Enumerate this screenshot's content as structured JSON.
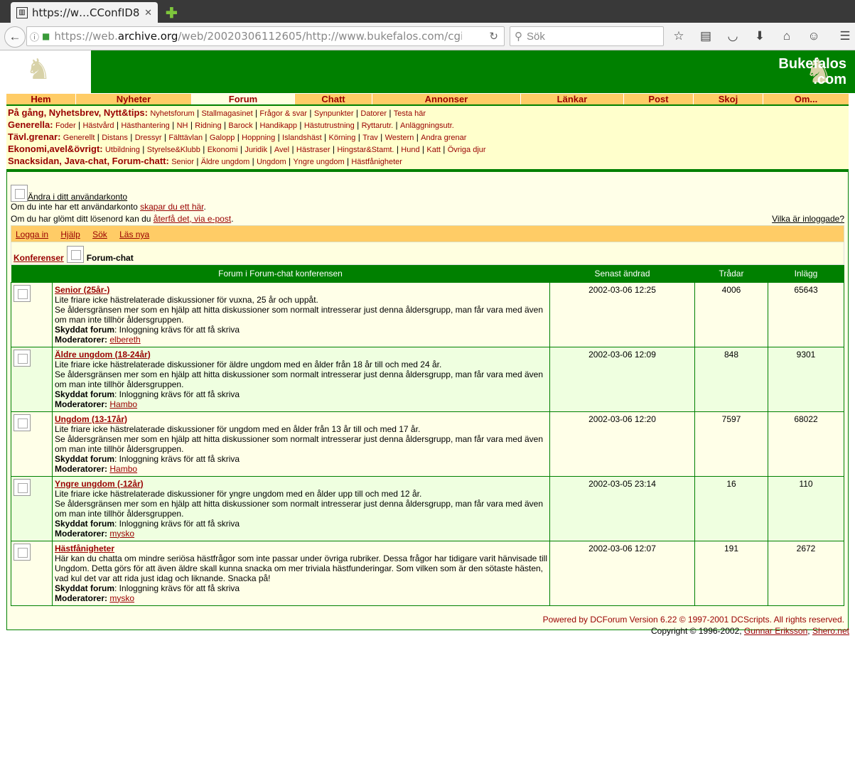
{
  "browser": {
    "tab_title": "https://w…CConfID8",
    "tab_close": "✕",
    "url_prefix": "https://web.",
    "url_host": "archive.org",
    "url_path": "/web/20020306112605/http://www.bukefalos.com/cgi/dcf/",
    "search_placeholder": "Sök"
  },
  "banner": {
    "brand_line1": "Bukefalos",
    "brand_line2": ".com"
  },
  "menu": [
    "Hem",
    "Nyheter",
    "Forum",
    "Chatt",
    "Annonser",
    "Länkar",
    "Post",
    "Skoj",
    "Om..."
  ],
  "subnav": [
    {
      "head": "På gång, Nyhetsbrev, Nytt&tips:",
      "links": [
        "Nyhetsforum",
        "Stallmagasinet",
        "Frågor & svar",
        "Synpunkter",
        "Datorer",
        "Testa här"
      ]
    },
    {
      "head": "Generella:",
      "links": [
        "Foder",
        "Hästvård",
        "Hästhantering",
        "NH",
        "Ridning",
        "Barock",
        "Handikapp",
        "Hästutrustning",
        "Ryttarutr.",
        "Anläggningsutr."
      ]
    },
    {
      "head": "Tävl.grenar:",
      "links": [
        "Generellt",
        "Distans",
        "Dressyr",
        "Fälttävlan",
        "Galopp",
        "Hoppning",
        "Islandshäst",
        "Körning",
        "Trav",
        "Western",
        "Andra grenar"
      ]
    },
    {
      "head": "Ekonomi,avel&övrigt:",
      "links": [
        "Utbildning",
        "Styrelse&Klubb",
        "Ekonomi",
        "Juridik",
        "Avel",
        "Hästraser",
        "Hingstar&Stamt.",
        "Hund",
        "Katt",
        "Övriga djur"
      ]
    },
    {
      "head": "Snacksidan, Java-chat, Forum-chatt:",
      "links": [
        "Senior",
        "Äldre ungdom",
        "Ungdom",
        "Yngre ungdom",
        "Hästfånigheter"
      ]
    }
  ],
  "account": {
    "edit": "Ändra i ditt användarkonto",
    "no_account": "Om du inte har ett användarkonto ",
    "create_link": "skapar du ett här",
    "forgot": "Om du har glömt ditt lösenord kan du ",
    "forgot_link": "återfå det, via e-post",
    "who": "Vilka är inloggade?"
  },
  "actions": [
    "Logga in",
    "Hjälp",
    "Sök",
    "Läs nya"
  ],
  "crumb": {
    "conf": "Konferenser",
    "current": "Forum-chat"
  },
  "table": {
    "headers": [
      "Forum i Forum-chat konferensen",
      "Senast ändrad",
      "Trådar",
      "Inlägg"
    ],
    "rows": [
      {
        "name": "Senior (25år-)",
        "desc": "Lite friare icke hästrelaterade diskussioner för vuxna, 25 år och uppåt.",
        "age": "Se åldersgränsen mer som en hjälp att hitta diskussioner som normalt intresserar just denna åldersgrupp, man får vara med även om man inte tillhör åldersgruppen.",
        "prot_label": "Skyddat forum",
        "prot": ": Inloggning krävs för att få skriva",
        "mod_label": "Moderatorer:",
        "mod": "elbereth",
        "date": "2002-03-06 12:25",
        "threads": "4006",
        "posts": "65643"
      },
      {
        "name": "Äldre ungdom (18-24år)",
        "desc": "Lite friare icke hästrelaterade diskussioner för äldre ungdom med en ålder från 18 år till och med 24 år.",
        "age": "Se åldersgränsen mer som en hjälp att hitta diskussioner som normalt intresserar just denna åldersgrupp, man får vara med även om man inte tillhör åldersgruppen.",
        "prot_label": "Skyddat forum",
        "prot": ": Inloggning krävs för att få skriva",
        "mod_label": "Moderatorer:",
        "mod": "Hambo",
        "date": "2002-03-06 12:09",
        "threads": "848",
        "posts": "9301"
      },
      {
        "name": "Ungdom (13-17år)",
        "desc": "Lite friare icke hästrelaterade diskussioner för ungdom med en ålder från 13 år till och med 17 år.",
        "age": "Se åldersgränsen mer som en hjälp att hitta diskussioner som normalt intresserar just denna åldersgrupp, man får vara med även om man inte tillhör åldersgruppen.",
        "prot_label": "Skyddat forum",
        "prot": ": Inloggning krävs för att få skriva",
        "mod_label": "Moderatorer:",
        "mod": "Hambo",
        "date": "2002-03-06 12:20",
        "threads": "7597",
        "posts": "68022"
      },
      {
        "name": "Yngre ungdom (-12år)",
        "desc": "Lite friare icke hästrelaterade diskussioner för yngre ungdom med en ålder upp till och med 12 år.",
        "age": "Se åldersgränsen mer som en hjälp att hitta diskussioner som normalt intresserar just denna åldersgrupp, man får vara med även om man inte tillhör åldersgruppen.",
        "prot_label": "Skyddat forum",
        "prot": ": Inloggning krävs för att få skriva",
        "mod_label": "Moderatorer:",
        "mod": "mysko",
        "date": "2002-03-05 23:14",
        "threads": "16",
        "posts": "110"
      },
      {
        "name": "Hästfånigheter",
        "desc": "Här kan du chatta om mindre seriösa hästfrågor som inte passar under övriga rubriker. Dessa frågor har tidigare varit hänvisade till Ungdom. Detta görs för att även äldre skall kunna snacka om mer triviala hästfunderingar. Som vilken som är den sötaste hästen, vad kul det var att rida just idag och liknande. Snacka på!",
        "age": "",
        "prot_label": "Skyddat forum",
        "prot": ": Inloggning krävs för att få skriva",
        "mod_label": "Moderatorer:",
        "mod": "mysko",
        "date": "2002-03-06 12:07",
        "threads": "191",
        "posts": "2672"
      }
    ]
  },
  "footer": {
    "powered": "Powered by DCForum Version 6.22 © 1997-2001 DCScripts. All rights reserved.",
    "copy_prefix": "Copyright © 1996-2002, ",
    "copy_name": "Gunnar Eriksson",
    "copy_sep": ", ",
    "copy_site": "Shero.net"
  }
}
